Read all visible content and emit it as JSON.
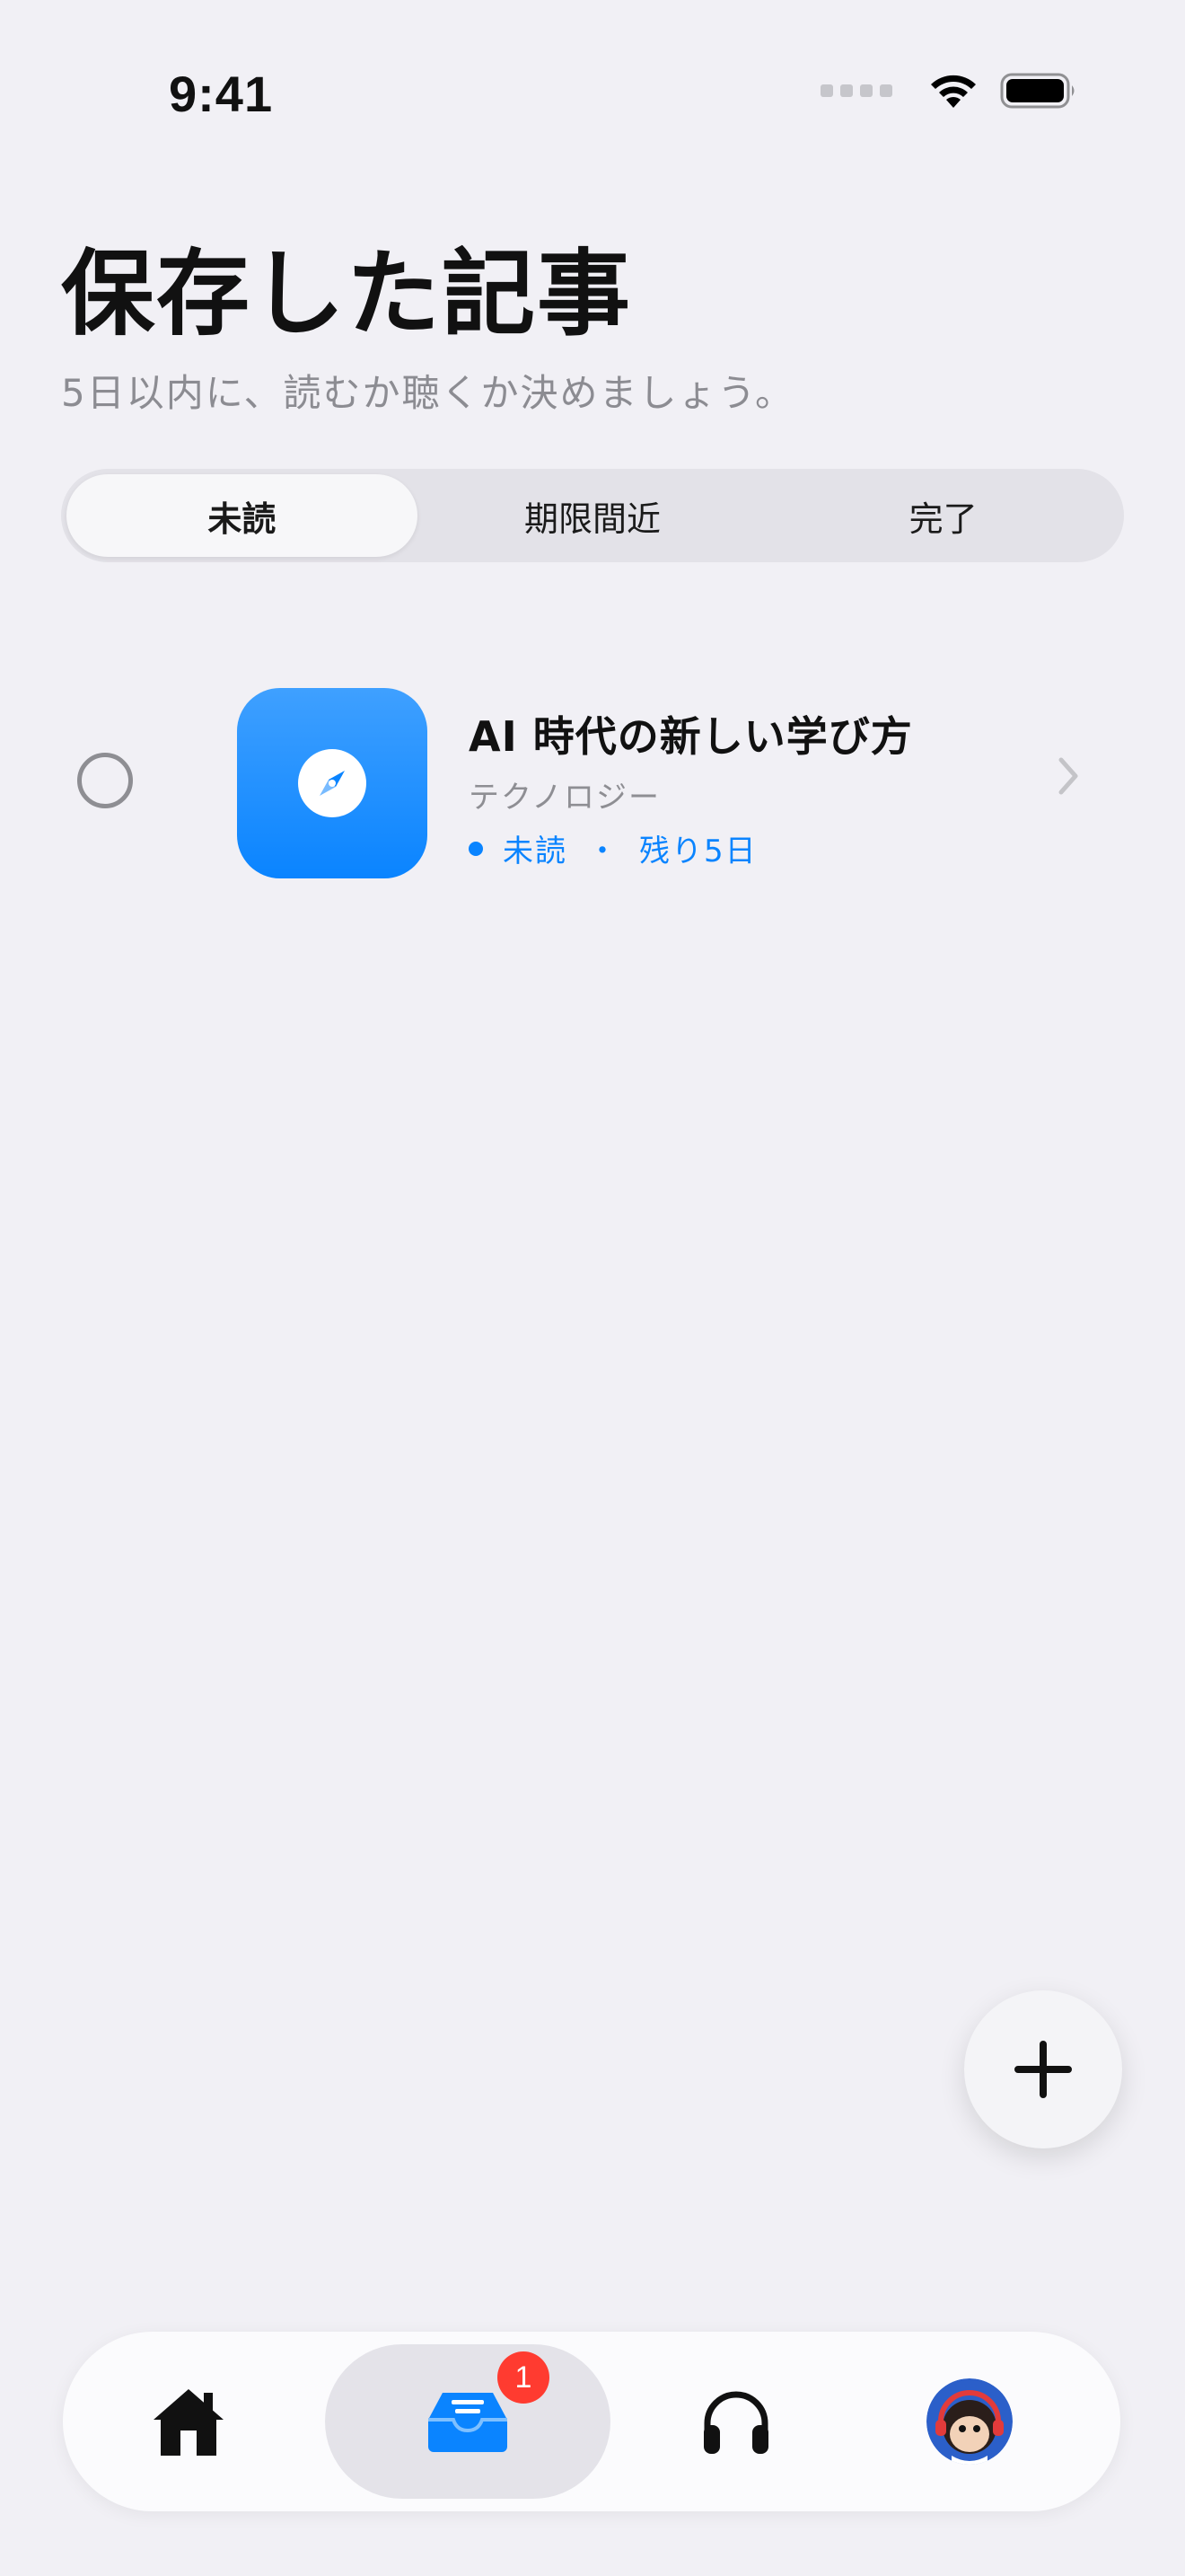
{
  "status_bar": {
    "time": "9:41"
  },
  "header": {
    "title": "保存した記事",
    "subtitle": "5日以内に、読むか聴くか決めましょう。"
  },
  "segments": [
    {
      "label": "未読",
      "selected": true
    },
    {
      "label": "期限間近",
      "selected": false
    },
    {
      "label": "完了",
      "selected": false
    }
  ],
  "articles": [
    {
      "title": "AI 時代の新しい学び方",
      "category": "テクノロジー",
      "status": "未読",
      "separator": "・",
      "remaining": "残り5日",
      "icon": "compass-icon",
      "accent": "#0a84ff"
    }
  ],
  "tab_bar": {
    "home_icon": "home-icon",
    "inbox_icon": "inbox-tray-icon",
    "inbox_badge": "1",
    "listen_icon": "headphones-icon",
    "profile_icon": "avatar-monkey"
  },
  "fab": {
    "icon": "plus-icon"
  },
  "colors": {
    "background": "#f1f0f5",
    "accent": "#0a84ff",
    "badge": "#ff3b30"
  }
}
